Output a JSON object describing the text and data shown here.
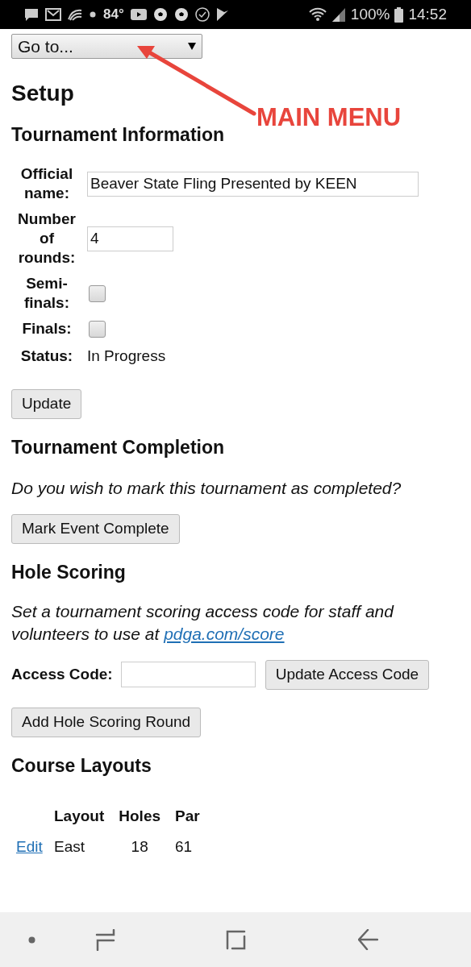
{
  "status_bar": {
    "temperature": "84°",
    "battery": "100%",
    "time": "14:52"
  },
  "goto_select": {
    "value": "Go to..."
  },
  "annotation": {
    "label": "MAIN MENU"
  },
  "page_title": "Setup",
  "tournament_info": {
    "heading": "Tournament Information",
    "fields": [
      {
        "kind": "text",
        "label": "Official name:",
        "value": "Beaver State Fling Presented by KEEN"
      },
      {
        "kind": "number",
        "label": "Number of rounds:",
        "value": "4"
      },
      {
        "kind": "checkbox",
        "label": "Semi-finals:",
        "checked": false
      },
      {
        "kind": "checkbox",
        "label": "Finals:",
        "checked": false
      },
      {
        "kind": "static",
        "label": "Status:",
        "value": "In Progress"
      }
    ],
    "button": "Update"
  },
  "completion": {
    "heading": "Tournament Completion",
    "prompt": "Do you wish to mark this tournament as completed?",
    "button": "Mark Event Complete"
  },
  "hole_scoring": {
    "heading": "Hole Scoring",
    "description": "Set a tournament scoring access code for staff and volunteers to use at",
    "link": "pdga.com/score",
    "access_label": "Access Code:",
    "access_button": "Update Access Code",
    "add_button": "Add Hole Scoring Round"
  },
  "course_layouts": {
    "heading": "Course Layouts",
    "columns": [
      "Layout",
      "Holes",
      "Par"
    ],
    "rows": [
      {
        "action": "Edit",
        "layout": "East",
        "holes": "18",
        "par": "61"
      }
    ]
  }
}
